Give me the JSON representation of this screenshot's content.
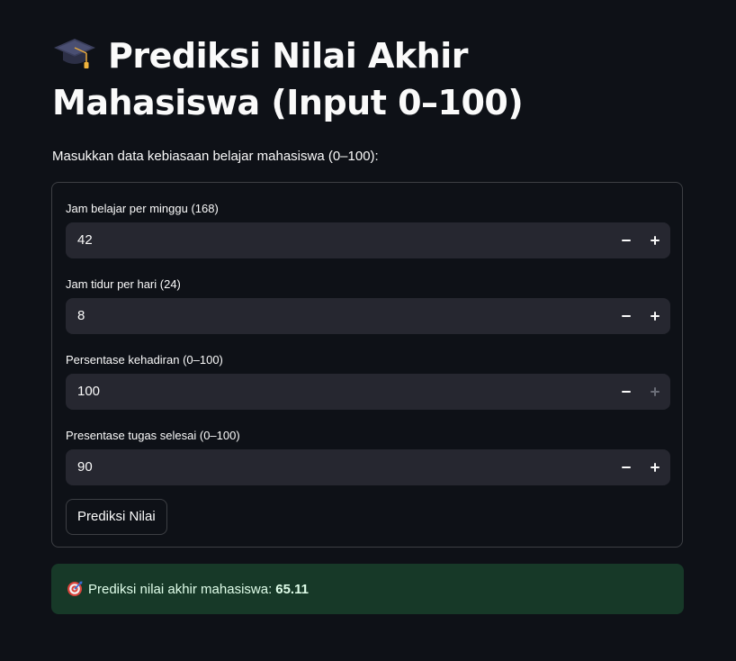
{
  "header": {
    "title": "Prediksi Nilai Akhir Mahasiswa (Input 0–100)",
    "icon": "graduation-cap-icon"
  },
  "intro": "Masukkan data kebiasaan belajar mahasiswa (0–100):",
  "form": {
    "fields": [
      {
        "label": "Jam belajar per minggu (168)",
        "value": "42"
      },
      {
        "label": "Jam tidur per hari (24)",
        "value": "8"
      },
      {
        "label": "Persentase kehadiran (0–100)",
        "value": "100"
      },
      {
        "label": "Presentase tugas selesai (0–100)",
        "value": "90"
      }
    ],
    "submit_label": "Prediksi Nilai"
  },
  "result": {
    "icon": "target-icon",
    "label": "Prediksi nilai akhir mahasiswa:",
    "value": "65.11"
  },
  "colors": {
    "background": "#0e1117",
    "input_bg": "#262730",
    "success_bg": "#173928",
    "text": "#fafafa"
  }
}
